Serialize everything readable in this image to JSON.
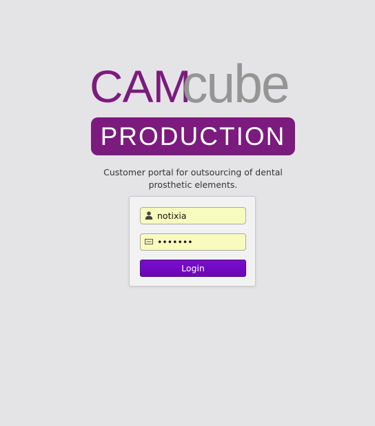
{
  "logo": {
    "word_part1": "CAM",
    "word_part2": "cube",
    "band_text": "PRODUCTION",
    "color_primary": "#7b1b7e",
    "color_secondary": "#959595"
  },
  "tagline": "Customer portal for outsourcing of dental prosthetic elements.",
  "login_form": {
    "username_value": "notixia",
    "username_icon": "user-icon",
    "password_value": "1234567",
    "password_icon": "key-icon",
    "field_background": "#f7fbbe",
    "submit_label": "Login",
    "submit_color": "#7a0fcc"
  }
}
